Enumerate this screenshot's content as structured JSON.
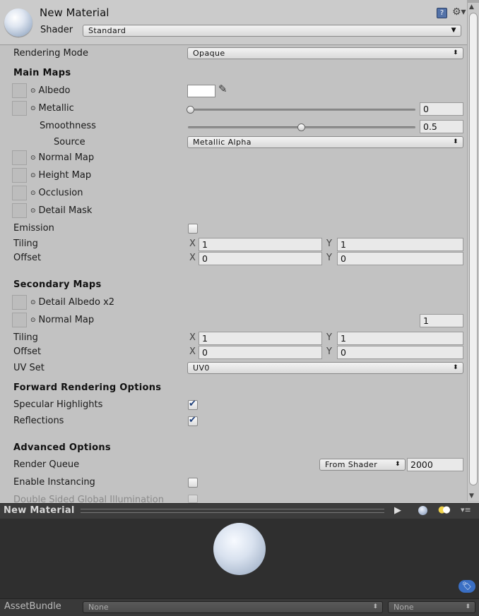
{
  "header": {
    "title": "New Material",
    "shader_label": "Shader",
    "shader_value": "Standard",
    "help_icon": "book-help-icon",
    "settings_icon": "gear-icon"
  },
  "rendering_mode": {
    "label": "Rendering Mode",
    "value": "Opaque"
  },
  "main_maps": {
    "title": "Main Maps",
    "albedo": "Albedo",
    "metallic": {
      "label": "Metallic",
      "value": "0",
      "slider_fraction": 0.0
    },
    "smoothness": {
      "label": "Smoothness",
      "value": "0.5",
      "slider_fraction": 0.5
    },
    "source": {
      "label": "Source",
      "value": "Metallic Alpha"
    },
    "normal_map": "Normal Map",
    "height_map": "Height Map",
    "occlusion": "Occlusion",
    "detail_mask": "Detail Mask",
    "emission": "Emission",
    "tiling": {
      "label": "Tiling",
      "x": "1",
      "y": "1"
    },
    "offset": {
      "label": "Offset",
      "x": "0",
      "y": "0"
    }
  },
  "axis": {
    "x": "X",
    "y": "Y"
  },
  "secondary_maps": {
    "title": "Secondary Maps",
    "detail_albedo": "Detail Albedo x2",
    "normal_map": "Normal Map",
    "normal_scale": "1",
    "tiling": {
      "label": "Tiling",
      "x": "1",
      "y": "1"
    },
    "offset": {
      "label": "Offset",
      "x": "0",
      "y": "0"
    },
    "uv_set": {
      "label": "UV Set",
      "value": "UV0"
    }
  },
  "forward": {
    "title": "Forward Rendering Options",
    "specular": {
      "label": "Specular Highlights",
      "checked": true
    },
    "reflections": {
      "label": "Reflections",
      "checked": true
    }
  },
  "advanced": {
    "title": "Advanced Options",
    "render_queue": {
      "label": "Render Queue",
      "mode": "From Shader",
      "value": "2000"
    },
    "instancing": {
      "label": "Enable Instancing",
      "checked": false
    },
    "double_sided_gi": {
      "label": "Double Sided Global Illumination",
      "checked": false
    }
  },
  "preview": {
    "title": "New Material",
    "play_icon": "play-icon",
    "sphere_icon": "sphere-icon",
    "light_icon": "lights-icon",
    "menu_icon": "menu-icon"
  },
  "asset_bundle": {
    "label": "AssetBundle",
    "name": "None",
    "variant": "None"
  },
  "colors": {
    "albedo": "#ffffff",
    "check": "#1e3f7a",
    "tag": "#3a6fc4"
  }
}
